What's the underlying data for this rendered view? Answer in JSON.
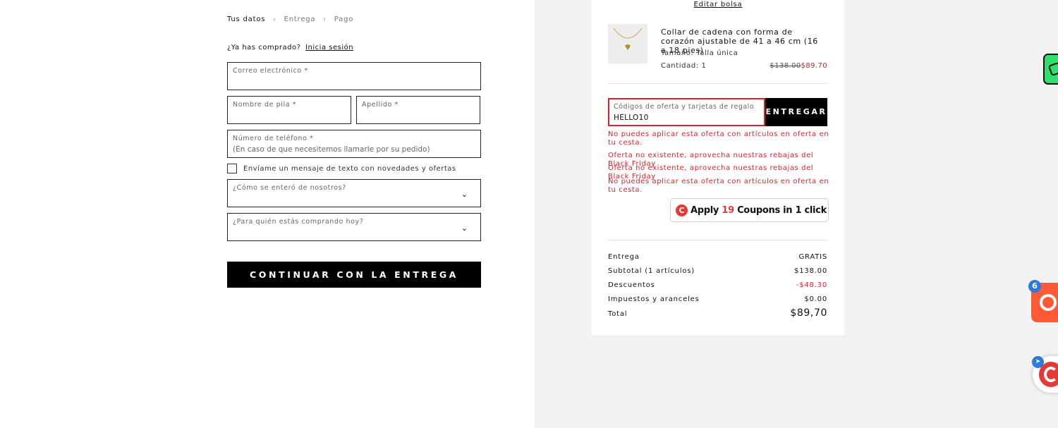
{
  "breadcrumb": [
    "Tus datos",
    "Entrega",
    "Pago"
  ],
  "login": {
    "prompt": "¿Ya has comprado?",
    "link": "Inicia sesión"
  },
  "form": {
    "email_label": "Correo electrónico *",
    "first_name_label": "Nombre de pila *",
    "last_name_label": "Apellido *",
    "phone_label": "Número de teléfono *",
    "phone_placeholder": "(En caso de que necesitemos llamarle por su pedido)",
    "sms_optin": "Envíame un mensaje de texto con novedades y ofertas",
    "how_heard_label": "¿Cómo se enteró de nosotros?",
    "for_whom_label": "¿Para quién estás comprando hoy?",
    "continue_button": "CONTINUAR CON LA ENTREGA"
  },
  "summary": {
    "edit_bag": "Editar bolsa",
    "product": {
      "name": "Collar de cadena con forma de corazón ajustable de 41 a 46 cm (16 a 18 pies)",
      "size": "Tamaño: Talla única",
      "quantity": "Cantidad: 1",
      "old_price": "$138.00",
      "new_price": "$89.70"
    },
    "code_label": "Códigos de oferta y tarjetas de regalo",
    "code_value": "HELLO10",
    "apply_button": "ENTREGAR",
    "errors": [
      "No puedes aplicar esta oferta con artículos en oferta en tu cesta.",
      "Oferta no existente, aprovecha nuestras rebajas del Black Friday",
      "Oferta no existente, aprovecha nuestras rebajas del Black Friday",
      "No puedes aplicar esta oferta con artículos en oferta en tu cesta."
    ],
    "coupons": {
      "pre": "Apply ",
      "count": "19",
      "post": " Coupons in 1 click"
    },
    "rows": [
      {
        "label": "Entrega",
        "value": "GRATIS"
      },
      {
        "label": "Subtotal (1 artículos)",
        "value": "$138.00"
      },
      {
        "label": "Descuentos",
        "value": "-$48.30"
      },
      {
        "label": "Impuestos y aranceles",
        "value": "$0.00"
      },
      {
        "label": "Total",
        "value": "$89,70"
      }
    ]
  },
  "floating": {
    "badge_count": "6"
  },
  "colors": {
    "error": "#d8232a",
    "accent_green": "#2ee06b",
    "accent_orange": "#ff5a36"
  }
}
